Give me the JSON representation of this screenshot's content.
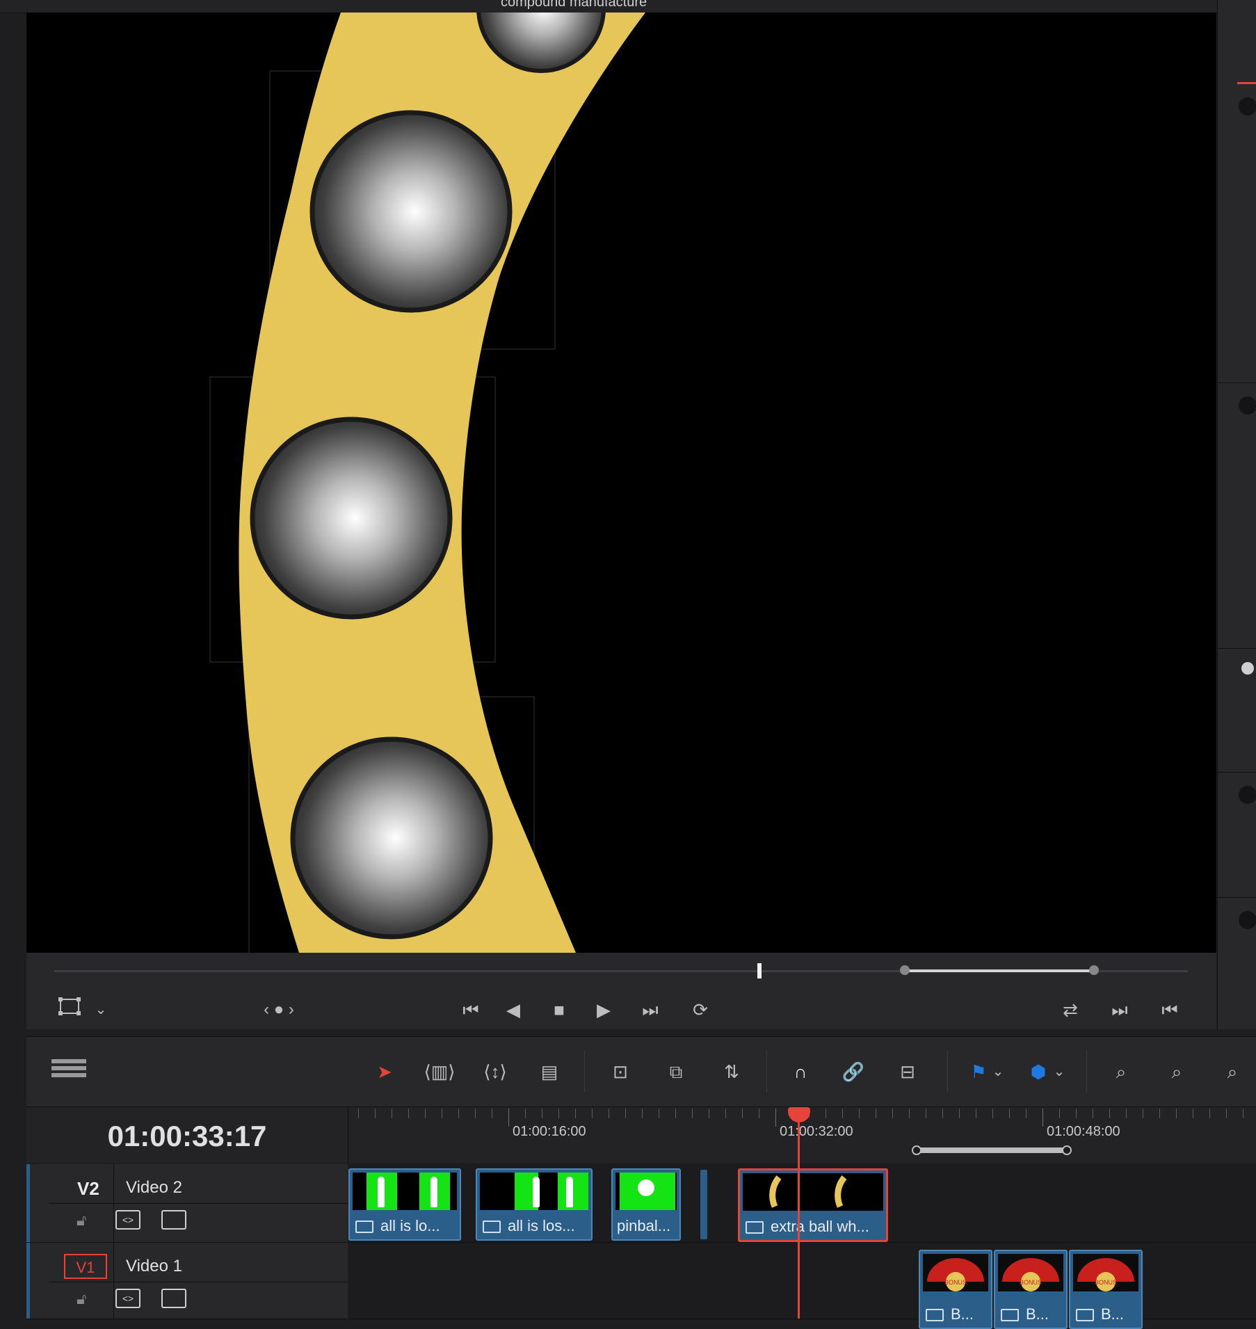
{
  "topbar": {
    "zoom": "",
    "timecode_left": "",
    "title": "compound manufacture",
    "timecode_right": ""
  },
  "viewer": {
    "clip_description": "yellow arc with grey balls"
  },
  "transport": {
    "icons": [
      "frame-icon",
      "prev-clip-icon",
      "step-back-icon",
      "stop-icon",
      "play-icon",
      "skip-end-icon",
      "loop-icon"
    ]
  },
  "timeline": {
    "current_timecode": "01:00:33:17",
    "ruler_labels": [
      "01:00:16:00",
      "01:00:32:00",
      "01:00:48:00"
    ],
    "tracks": [
      {
        "id": "V2",
        "name": "Video 2"
      },
      {
        "id": "V1",
        "name": "Video 1"
      }
    ],
    "v2_clips": [
      {
        "label": "all is lo..."
      },
      {
        "label": "all is los..."
      },
      {
        "label": "pinbal..."
      },
      {
        "label": "extra ball wh..."
      }
    ],
    "v1_clips": [
      {
        "label": "B..."
      },
      {
        "label": "B..."
      },
      {
        "label": "B..."
      }
    ],
    "bonus_text": "BONUS"
  },
  "colors": {
    "accent_red": "#e6443a",
    "clip_blue": "#2b5f8a",
    "arc_yellow": "#e7c659",
    "marker_blue": "#1f7ae0"
  }
}
